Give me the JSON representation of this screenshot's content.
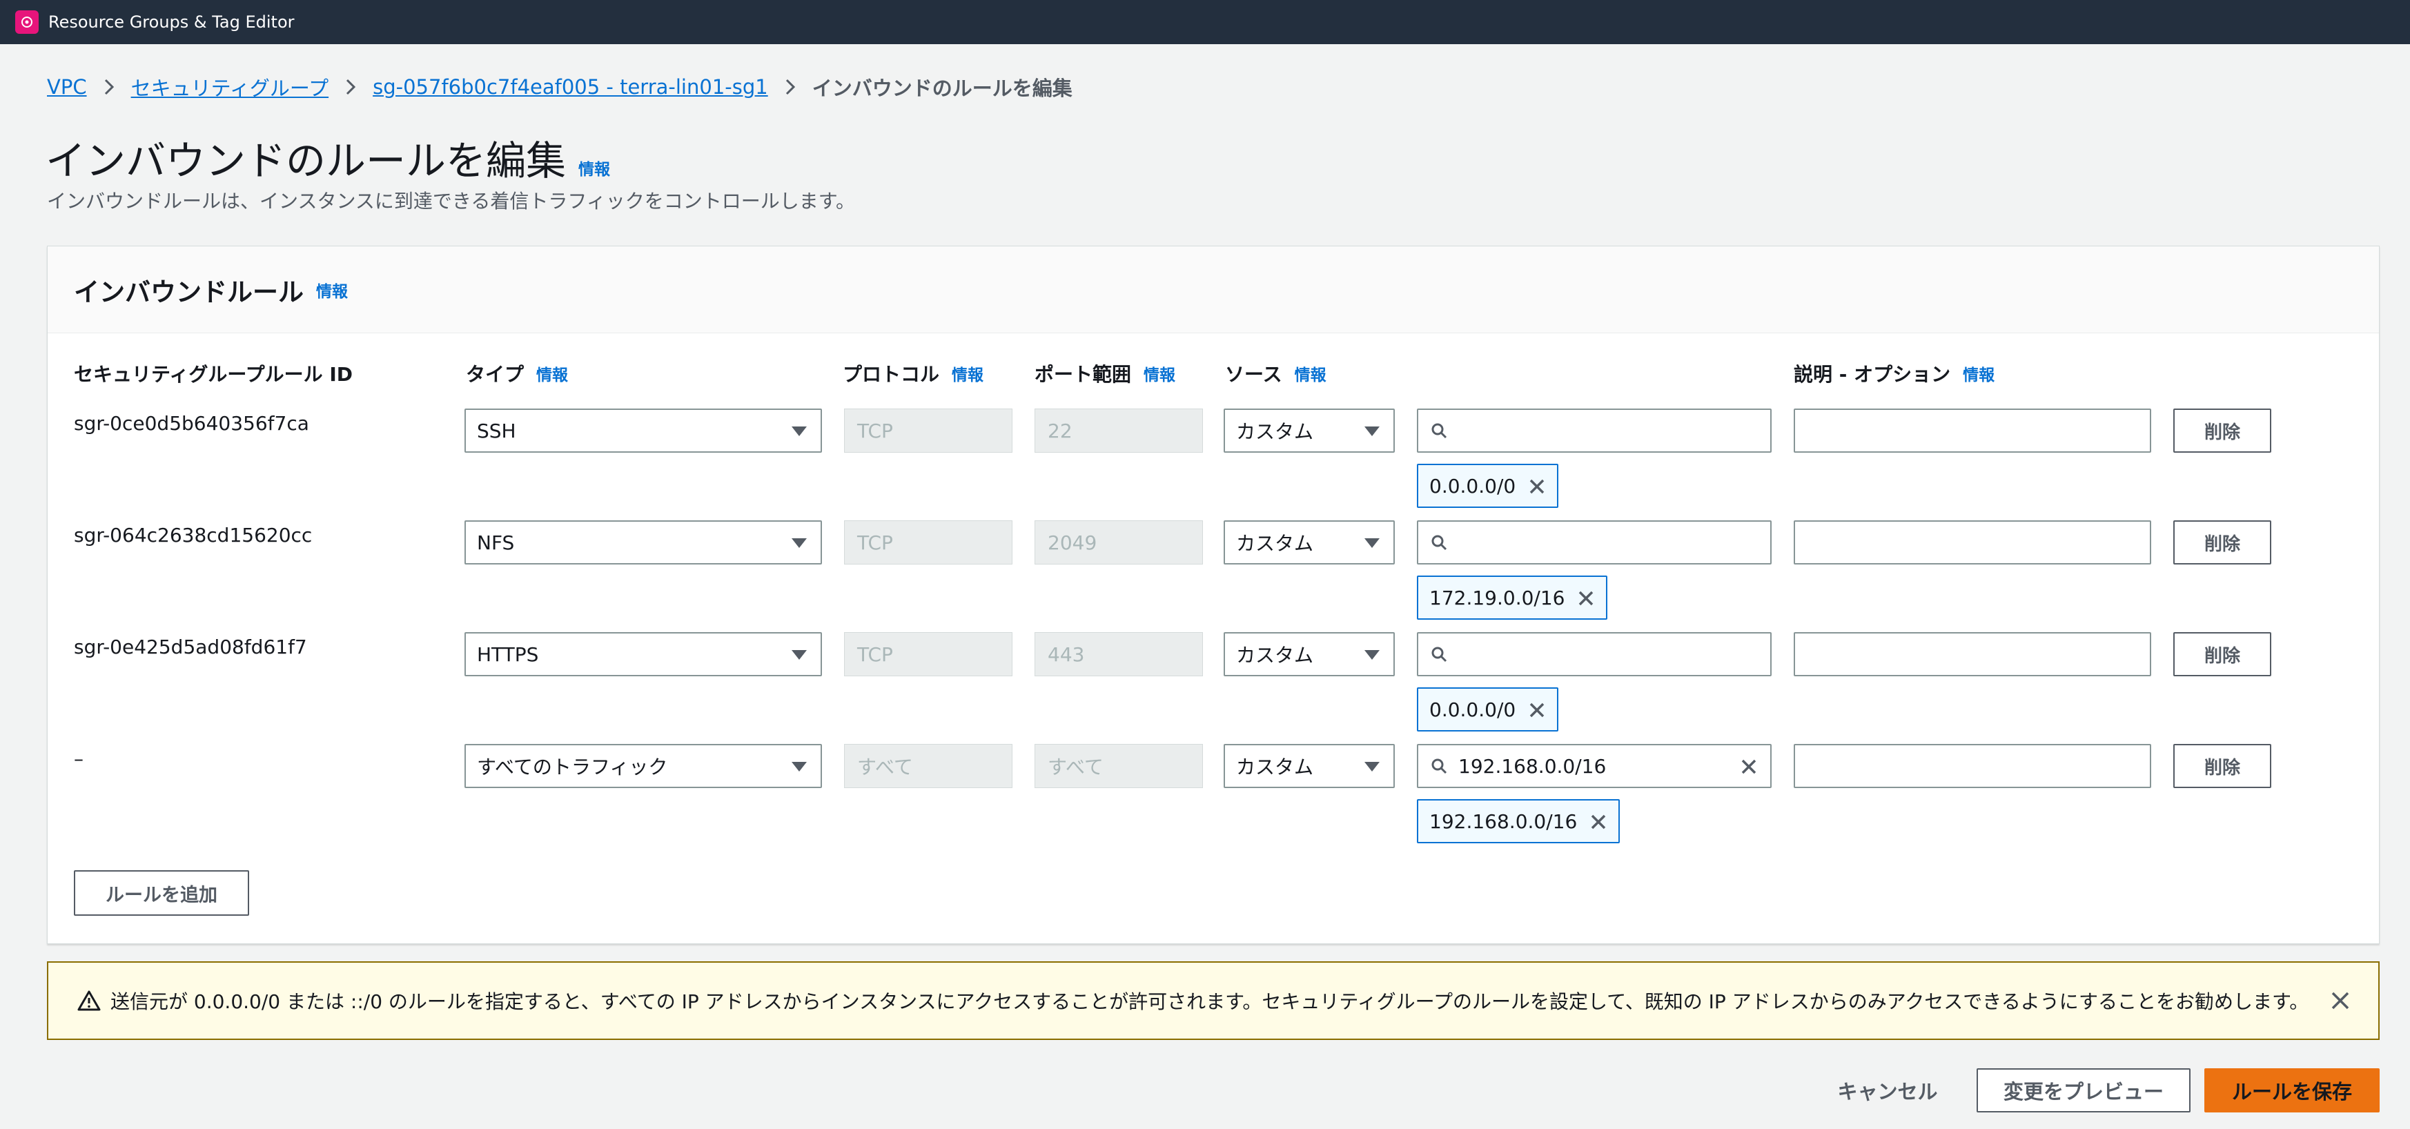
{
  "app": {
    "name": "Resource Groups & Tag Editor"
  },
  "breadcrumb": {
    "items": [
      "VPC",
      "セキュリティグループ",
      "sg-057f6b0c7f4eaf005 - terra-lin01-sg1"
    ],
    "current": "インバウンドのルールを編集"
  },
  "page": {
    "title": "インバウンドのルールを編集",
    "info": "情報",
    "description": "インバウンドルールは、インスタンスに到達できる着信トラフィックをコントロールします。"
  },
  "panel": {
    "title": "インバウンドルール",
    "info": "情報",
    "columns": {
      "rule_id": "セキュリティグループルール ID",
      "type": "タイプ",
      "protocol": "プロトコル",
      "port_range": "ポート範囲",
      "source": "ソース",
      "description": "説明 - オプション",
      "info": "情報"
    },
    "rows": [
      {
        "rule_id": "sgr-0ce0d5b640356f7ca",
        "type": "SSH",
        "protocol": "TCP",
        "port": "22",
        "source_type": "カスタム",
        "search_value": "",
        "token": "0.0.0.0/0",
        "delete": "削除"
      },
      {
        "rule_id": "sgr-064c2638cd15620cc",
        "type": "NFS",
        "protocol": "TCP",
        "port": "2049",
        "source_type": "カスタム",
        "search_value": "",
        "token": "172.19.0.0/16",
        "delete": "削除"
      },
      {
        "rule_id": "sgr-0e425d5ad08fd61f7",
        "type": "HTTPS",
        "protocol": "TCP",
        "port": "443",
        "source_type": "カスタム",
        "search_value": "",
        "token": "0.0.0.0/0",
        "delete": "削除"
      },
      {
        "rule_id": "–",
        "type": "すべてのトラフィック",
        "protocol": "すべて",
        "port": "すべて",
        "source_type": "カスタム",
        "search_value": "192.168.0.0/16",
        "token": "192.168.0.0/16",
        "delete": "削除"
      }
    ],
    "add_rule": "ルールを追加"
  },
  "warning": {
    "text": "送信元が 0.0.0.0/0 または ::/0 のルールを指定すると、すべての IP アドレスからインスタンスにアクセスすることが許可されます。セキュリティグループのルールを設定して、既知の IP アドレスからのみアクセスできるようにすることをお勧めします。"
  },
  "footer": {
    "cancel": "キャンセル",
    "preview": "変更をプレビュー",
    "save": "ルールを保存"
  },
  "colors": {
    "topbar": "#232f3e",
    "link": "#0972d3",
    "primary": "#ec7211",
    "token_border": "#0972d3",
    "warning_bg": "#fffce6"
  }
}
